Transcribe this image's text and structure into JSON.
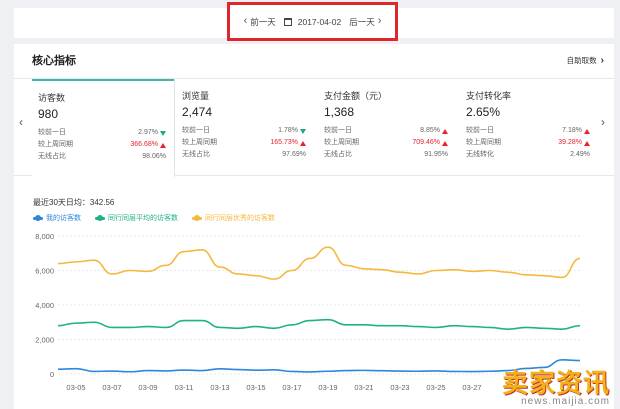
{
  "date_bar": {
    "prev_label": "前一天",
    "date": "2017-04-02",
    "next_label": "后一天"
  },
  "panel": {
    "title": "核心指标",
    "self_fetch": "自助取数"
  },
  "metrics": [
    {
      "name": "访客数",
      "value": "980",
      "rows": [
        {
          "label": "较前一日",
          "value": "2.97%",
          "dir": "down"
        },
        {
          "label": "较上周同期",
          "value": "366.68%",
          "dir": "up"
        },
        {
          "label": "无线占比",
          "value": "98.06%",
          "dir": "none"
        }
      ]
    },
    {
      "name": "浏览量",
      "value": "2,474",
      "rows": [
        {
          "label": "较前一日",
          "value": "1.78%",
          "dir": "down"
        },
        {
          "label": "较上周同期",
          "value": "165.73%",
          "dir": "up"
        },
        {
          "label": "无线占比",
          "value": "97.69%",
          "dir": "none"
        }
      ]
    },
    {
      "name": "支付金额（元）",
      "value": "1,368",
      "rows": [
        {
          "label": "较前一日",
          "value": "8.85%",
          "dir": "up"
        },
        {
          "label": "较上周同期",
          "value": "709.46%",
          "dir": "up"
        },
        {
          "label": "无线占比",
          "value": "91.95%",
          "dir": "none"
        }
      ]
    },
    {
      "name": "支付转化率",
      "value": "2.65%",
      "rows": [
        {
          "label": "较前一日",
          "value": "7.18%",
          "dir": "up"
        },
        {
          "label": "较上周同期",
          "value": "39.28%",
          "dir": "up"
        },
        {
          "label": "无线转化",
          "value": "2.49%",
          "dir": "none"
        }
      ]
    }
  ],
  "avg_text": "最近30天日均：342.56",
  "watermark": {
    "big": "卖家资讯",
    "small": "news.maijia.com"
  },
  "colors": {
    "accent": "#3fb8a9",
    "up": "#e8232f",
    "down": "#1fa58a"
  },
  "chart_data": {
    "type": "line",
    "ylim": [
      0,
      8000
    ],
    "yticks": [
      "0",
      "2,000",
      "4,000",
      "6,000",
      "8,000"
    ],
    "x": [
      "03-04",
      "03-05",
      "03-06",
      "03-07",
      "03-08",
      "03-09",
      "03-10",
      "03-11",
      "03-12",
      "03-13",
      "03-14",
      "03-15",
      "03-16",
      "03-17",
      "03-18",
      "03-19",
      "03-20",
      "03-21",
      "03-22",
      "03-23",
      "03-24",
      "03-25",
      "03-26",
      "03-27",
      "03-28",
      "03-29",
      "03-30",
      "03-31",
      "04-01",
      "04-02"
    ],
    "xtick_labels": [
      "03-05",
      "03-07",
      "03-09",
      "03-11",
      "03-13",
      "03-15",
      "03-17",
      "03-19",
      "03-21",
      "03-23",
      "03-25",
      "03-27"
    ],
    "series": [
      {
        "name": "我的访客数",
        "color": "#2e86de",
        "values": [
          280,
          310,
          150,
          170,
          130,
          200,
          180,
          230,
          200,
          300,
          260,
          220,
          240,
          150,
          120,
          160,
          200,
          210,
          190,
          170,
          160,
          180,
          150,
          140,
          160,
          200,
          320,
          380,
          820,
          780
        ]
      },
      {
        "name": "同行同层平均的访客数",
        "color": "#1fb28a",
        "values": [
          2800,
          2950,
          3000,
          2700,
          2700,
          2750,
          2700,
          3100,
          3100,
          2700,
          2650,
          2750,
          2650,
          2850,
          3100,
          3150,
          2850,
          2850,
          2800,
          2800,
          2750,
          2700,
          2800,
          2750,
          2700,
          2600,
          2700,
          2650,
          2600,
          2800
        ]
      },
      {
        "name": "同行同层优秀的访客数",
        "color": "#f5b83d",
        "values": [
          6400,
          6500,
          6600,
          5800,
          6000,
          5950,
          6300,
          7100,
          7200,
          6200,
          5800,
          5700,
          5500,
          6000,
          6700,
          7350,
          6300,
          6100,
          6050,
          5900,
          5800,
          6000,
          6050,
          5950,
          6000,
          5900,
          5750,
          5700,
          5600,
          6700
        ]
      }
    ]
  }
}
